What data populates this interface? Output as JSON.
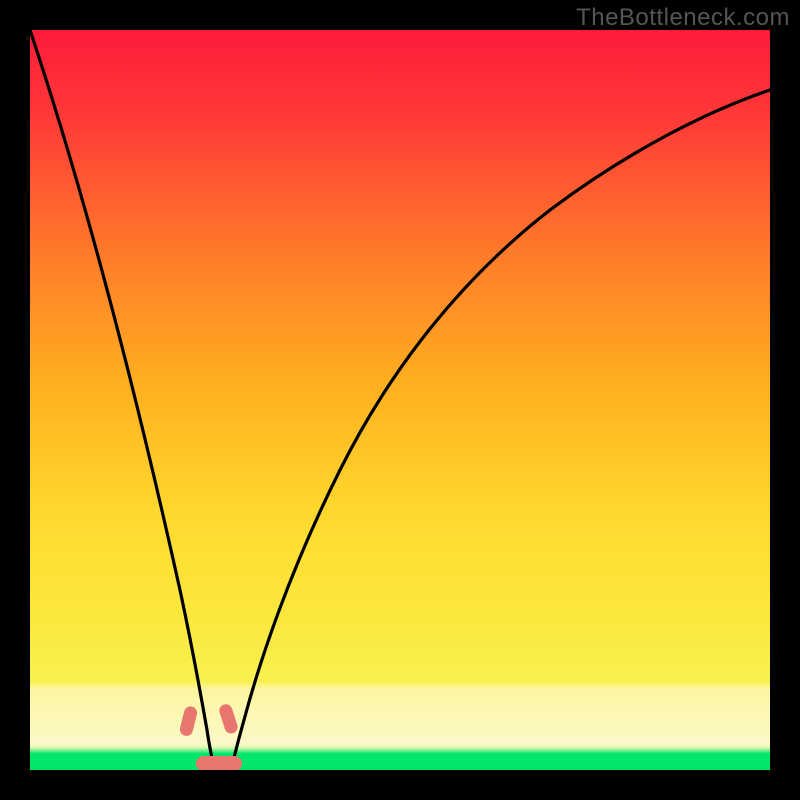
{
  "watermark": {
    "text": "TheBottleneck.com"
  },
  "chart_data": {
    "type": "line",
    "title": "",
    "xlabel": "",
    "ylabel": "",
    "xlim": [
      0,
      100
    ],
    "ylim": [
      0,
      100
    ],
    "curve": {
      "x": [
        0,
        2,
        4,
        6,
        8,
        10,
        12,
        14,
        16,
        18,
        19,
        20,
        21,
        22,
        23,
        24,
        25,
        26,
        27,
        28,
        29,
        30,
        32,
        35,
        40,
        45,
        50,
        55,
        60,
        65,
        70,
        75,
        80,
        85,
        90,
        95,
        100
      ],
      "y": [
        100,
        92,
        84,
        76,
        68,
        60,
        52,
        44,
        36,
        24,
        17,
        10,
        5,
        2,
        0.5,
        0,
        0,
        0,
        0.5,
        2,
        5,
        9,
        16,
        24,
        36,
        45,
        52,
        58,
        63,
        67,
        71,
        74.5,
        77.5,
        80,
        82,
        84,
        86
      ]
    },
    "colors": {
      "gradient_top": "#fd1b3a",
      "gradient_mid1": "#ff8a1f",
      "gradient_mid2": "#fde33a",
      "gradient_band": "#fcf6a0",
      "gradient_green": "#00e56a",
      "curve_stroke": "#000000",
      "marker_fill": "#e8766f",
      "frame": "#000000"
    },
    "markers": [
      {
        "x": 21.3,
        "y": 6.0,
        "label": "left-shoulder"
      },
      {
        "x": 26.7,
        "y": 6.2,
        "label": "right-shoulder"
      },
      {
        "x": 24.0,
        "y": 0.5,
        "label": "valley-base"
      }
    ],
    "green_band_y": [
      0,
      2.2
    ],
    "pale_band_y": [
      2.2,
      11
    ]
  }
}
